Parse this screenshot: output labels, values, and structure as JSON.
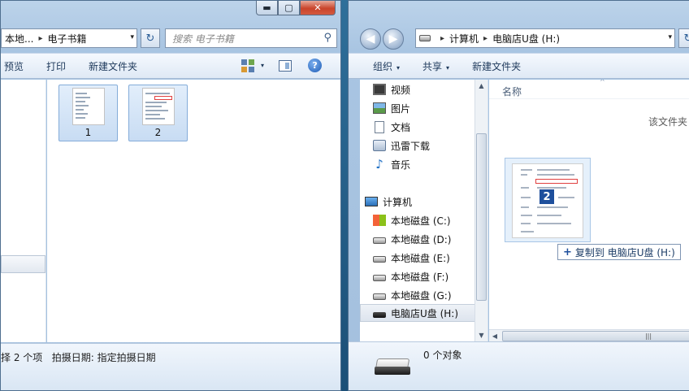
{
  "left_window": {
    "caption": {
      "min": "▬",
      "max": "▢",
      "close": "✕"
    },
    "address": {
      "parts": [
        "本地...",
        "电子书籍"
      ],
      "sep": "▸",
      "dropdown": "▾"
    },
    "refresh": "↻",
    "search_placeholder": "搜索 电子书籍",
    "search_icon": "magnifier-icon",
    "toolbar": {
      "preview": "预览",
      "print": "打印",
      "new_folder": "新建文件夹",
      "view_dd": "▾"
    },
    "files": [
      {
        "name": "1"
      },
      {
        "name": "2"
      }
    ],
    "status": "择 2 个项   拍摄日期: 指定拍摄日期"
  },
  "right_window": {
    "back": "◀",
    "forward": "▶",
    "address": {
      "parts": [
        "计算机",
        "电脑店U盘 (H:)"
      ],
      "sep": "▸",
      "dropdown": "▾"
    },
    "toolbar": {
      "organize": "组织",
      "share": "共享",
      "new_folder": "新建文件夹",
      "dd": "▾"
    },
    "nav": {
      "libraries": [
        {
          "label": "视频",
          "icon": "video-icon"
        },
        {
          "label": "图片",
          "icon": "picture-icon"
        },
        {
          "label": "文档",
          "icon": "document-icon"
        },
        {
          "label": "迅雷下载",
          "icon": "download-icon"
        },
        {
          "label": "音乐",
          "icon": "music-icon"
        }
      ],
      "computer": {
        "label": "计算机",
        "icon": "computer-icon"
      },
      "drives": [
        {
          "label": "本地磁盘 (C:)",
          "icon": "system-drive-icon"
        },
        {
          "label": "本地磁盘 (D:)",
          "icon": "drive-icon"
        },
        {
          "label": "本地磁盘 (E:)",
          "icon": "drive-icon"
        },
        {
          "label": "本地磁盘 (F:)",
          "icon": "drive-icon"
        },
        {
          "label": "本地磁盘 (G:)",
          "icon": "drive-icon"
        },
        {
          "label": "电脑店U盘 (H:)",
          "icon": "usb-drive-icon"
        }
      ]
    },
    "column_header": "名称",
    "empty_text": "该文件夹",
    "drag_badge": "2",
    "drag_tip": "复制到 电脑店U盘 (H:)",
    "drag_tip_icon": "+",
    "status": "0 个对象"
  }
}
